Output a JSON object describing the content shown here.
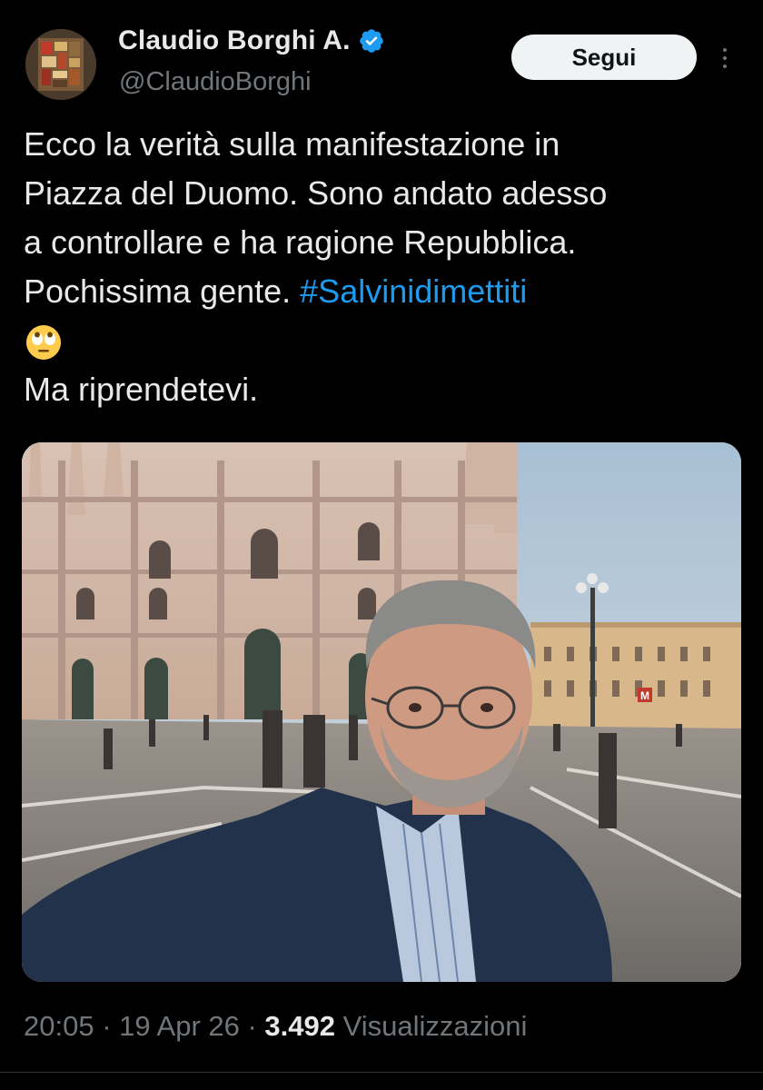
{
  "author": {
    "display_name": "Claudio Borghi A.",
    "handle": "@ClaudioBorghi",
    "verified": true,
    "verified_icon": "verified-badge-icon",
    "verified_color": "#1d9bf0"
  },
  "actions": {
    "follow_label": "Segui",
    "more_icon": "more-vertical-icon"
  },
  "tweet": {
    "lines": [
      "Ecco la verità sulla manifestazione in",
      "Piazza del Duomo. Sono andato adesso",
      "a controllare e ha ragione Repubblica.",
      "Pochissima gente. "
    ],
    "hashtag": "#Salvinidimettiti",
    "emoji_icon": "face-with-rolling-eyes-emoji",
    "last_line": "Ma riprendetevi.",
    "hashtag_color": "#1d9bf0"
  },
  "media": {
    "type": "photo",
    "metro_sign": "M"
  },
  "meta": {
    "time": "20:05",
    "sep1": " · ",
    "date": "19 Apr 26",
    "sep2": " · ",
    "views_count": "3.492",
    "views_label": " Visualizzazioni"
  },
  "colors": {
    "background": "#000000",
    "text": "#e7e9ea",
    "secondary": "#71767b",
    "accent": "#1d9bf0"
  }
}
